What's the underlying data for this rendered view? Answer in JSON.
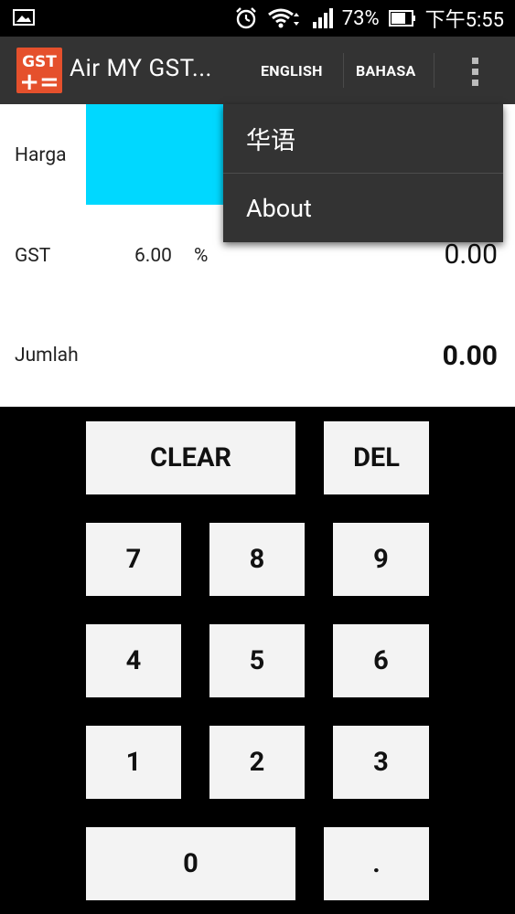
{
  "status_bar": {
    "battery": "73%",
    "time": "下午5:55",
    "icons": [
      "gallery-notification-icon",
      "alarm-icon",
      "wifi-icon",
      "signal-icon",
      "battery-icon"
    ]
  },
  "action_bar": {
    "logo_top": "GST",
    "logo_bottom": "+=",
    "title": "Air MY GST...",
    "english_label": "ENGLISH",
    "bahasa_label": "BAHASA",
    "overflow_icon": "overflow-menu-icon"
  },
  "display": {
    "harga_label": "Harga",
    "gst_label": "GST",
    "gst_rate": "6.00",
    "gst_percent": "%",
    "gst_value": "0.00",
    "jumlah_label": "Jumlah",
    "jumlah_value": "0.00",
    "harga_field_color": "#00d8ff"
  },
  "menu": {
    "items": [
      "华语",
      "About"
    ]
  },
  "keypad": {
    "clear": "CLEAR",
    "del": "DEL",
    "k7": "7",
    "k8": "8",
    "k9": "9",
    "k4": "4",
    "k5": "5",
    "k6": "6",
    "k1": "1",
    "k2": "2",
    "k3": "3",
    "k0": "0",
    "dot": "."
  },
  "colors": {
    "accent": "#00d8ff",
    "logo": "#e5502c",
    "action_bar": "#333333"
  }
}
